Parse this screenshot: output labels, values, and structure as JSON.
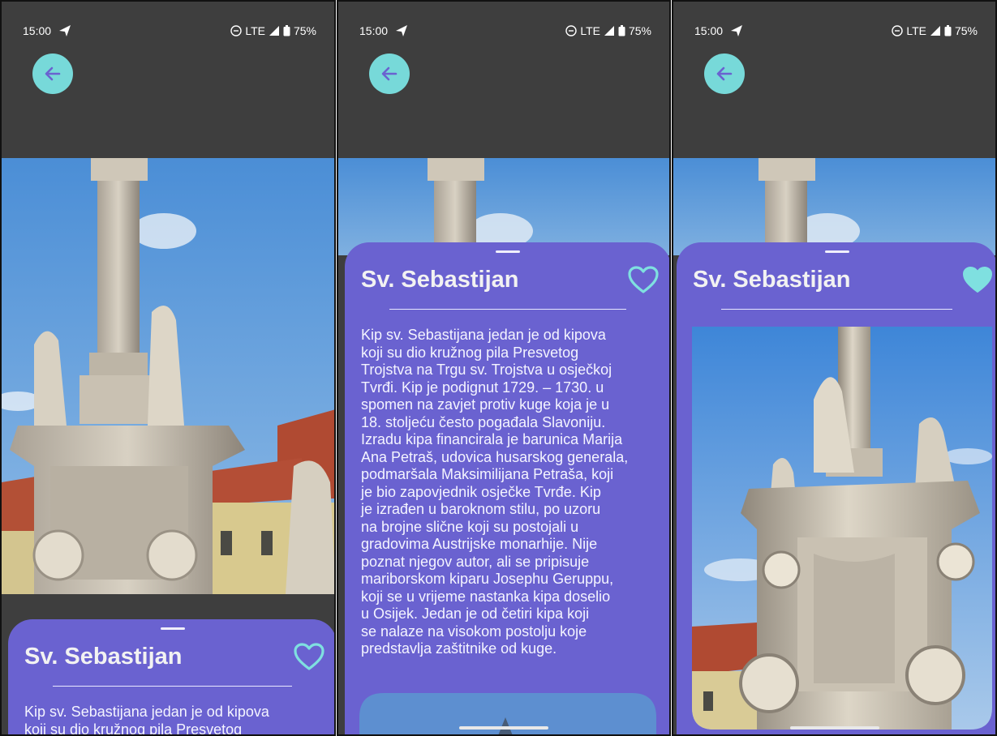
{
  "status": {
    "time": "15:00",
    "network": "LTE",
    "battery": "75%"
  },
  "landmark": {
    "title": "Sv. Sebastijan",
    "description": "Kip sv. Sebastijana jedan je od kipova\nkoji su dio kružnog pila  Presvetog\nTrojstva na Trgu sv. Trojstva u osječkoj\nTvrđi. Kip je podignut 1729. – 1730. u\nspomen na zavjet protiv kuge koja je u\n18. stoljeću često pogađala Slavoniju.\nIzradu kipa financirala je barunica Marija\nAna Petraš, udovica husarskog generala,\npodmaršala Maksimilijana Petraša, koji\nje bio zapovjednik osječke Tvrđe.  Kip\nje izrađen u baroknom stilu, po uzoru\nna brojne slične koji su postojali u\ngradovima Austrijske monarhije. Nije\npoznat njegov autor, ali se pripisuje\nmariborskom kiparu Josephu Geruppu,\nkoji se u vrijeme nastanka kipa doselio\nu Osijek. Jedan je od četiri kipa koji\nse nalaze na visokom postolju koje\npredstavlja zaštitnike od kuge.",
    "description_preview": "Kip sv. Sebastijana jedan je od kipova\nkoji su dio kružnog pila  Presvetog"
  },
  "screens": [
    {
      "name": "collapsed",
      "favorite": false
    },
    {
      "name": "expanded",
      "favorite": false
    },
    {
      "name": "favorited",
      "favorite": true
    }
  ],
  "colors": {
    "sheet": "#6a62d0",
    "accent": "#77d9d9",
    "background": "#3e3e3e"
  }
}
